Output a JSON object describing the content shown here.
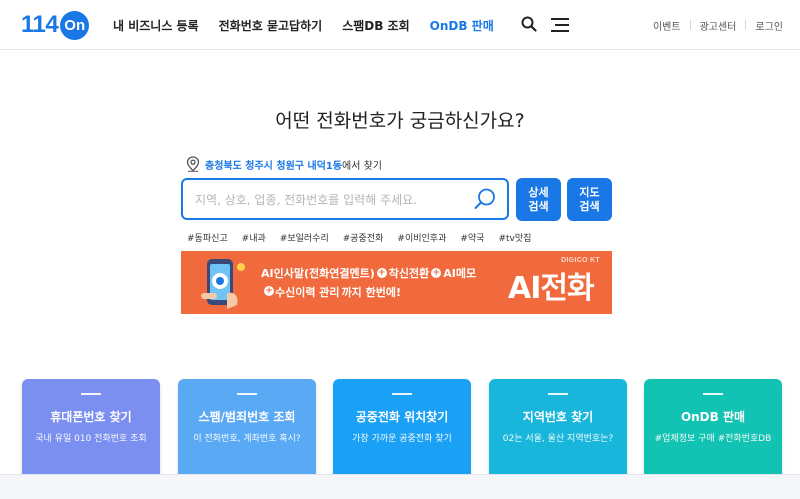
{
  "header": {
    "logo_num": "114",
    "logo_on": "On",
    "nav": [
      {
        "label": "내 비즈니스 등록"
      },
      {
        "label": "전화번호 묻고답하기"
      },
      {
        "label": "스팸DB 조회"
      },
      {
        "label": "OnDB 판매"
      }
    ],
    "util": [
      "이벤트",
      "광고센터",
      "로그인"
    ]
  },
  "main": {
    "headline": "어떤 전화번호가 궁금하신가요?",
    "location_region": "충청북도 청주시 청원구 내덕1동",
    "location_suffix": "에서 찾기",
    "search_placeholder": "지역, 상호, 업종, 전화번호를 입력해 주세요.",
    "btn_detail": "상세 검색",
    "btn_map": "지도 검색",
    "tags": [
      "#동파신고",
      "#내과",
      "#보일러수리",
      "#공중전화",
      "#이비인후과",
      "#약국",
      "#tv맛집"
    ]
  },
  "banner": {
    "brand": "DIGICO KT",
    "line1_a": "AI인사말(전화연결멘트)",
    "line1_b": "착신전환",
    "line1_c": "AI메모",
    "line2_a": "수신이력 관리",
    "line2_b": "까지 한번에!",
    "big": "AI전화"
  },
  "cards": [
    {
      "title": "휴대폰번호 찾기",
      "desc": "국내 유일 010 전화번호 조회",
      "color": "#7b8ff0"
    },
    {
      "title": "스팸/범죄번호 조회",
      "desc": "이 전화번호, 계좌번호 혹시?",
      "color": "#5aa9f5"
    },
    {
      "title": "공중전화 위치찾기",
      "desc": "가장 가까운 공중전화 찾기",
      "color": "#1aa0f5"
    },
    {
      "title": "지역번호 찾기",
      "desc": "02는 서울, 울산 지역번호는?",
      "color": "#19b6dc"
    },
    {
      "title": "OnDB 판매",
      "desc": "#업체정보 구매 #전화번호DB",
      "color": "#12c2b3"
    }
  ]
}
